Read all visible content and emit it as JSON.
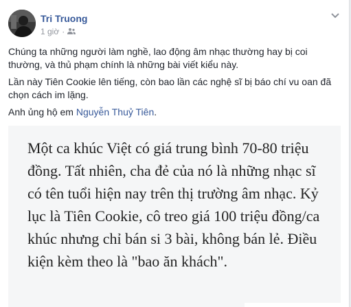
{
  "post": {
    "author": "Tri Truong",
    "time": "1 giờ",
    "audience_icon": "friends-icon",
    "more_icon": "more-options-icon",
    "paragraph1": "Chúng ta những người làm nghề, lao động âm nhạc thường hay bị coi thường, và thủ phạm chính là những bài viết kiểu này.",
    "paragraph2": "Lần này Tiên Cookie lên tiếng, còn bao lần các nghệ sĩ bị báo chí vu oan đã chọn cách im lặng.",
    "paragraph3_prefix": "Anh ủng hộ em ",
    "mention": "Nguyễn Thuỷ Tiên",
    "paragraph3_suffix": ".",
    "attached_text": "Một ca khúc Việt có giá trung bình 70-80 triệu đồng. Tất nhiên, cha đẻ của nó là những nhạc sĩ có tên tuổi hiện nay trên thị trường âm nhạc. Kỷ lục là Tiên Cookie, cô treo giá 100 triệu đồng/ca khúc nhưng chỉ bán si 3 bài, không bán lẻ. Điều kiện kèm theo là \"bao ăn khách\"."
  },
  "colors": {
    "link": "#365899",
    "text": "#1d2129",
    "meta": "#90949c",
    "quote_bg": "#f5f6f7"
  }
}
